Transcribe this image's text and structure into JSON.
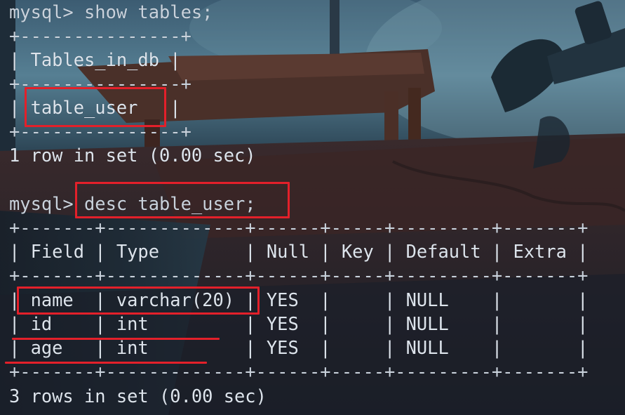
{
  "terminal": {
    "lines": {
      "cmd1": "mysql> show tables;",
      "border1": "+---------------+",
      "header1": "| Tables_in_db |",
      "border1b": "+---------------+",
      "row1": "| table_user   |",
      "border1c": "+---------------+",
      "result1": "1 row in set (0.00 sec)",
      "cmd2": "mysql> desc table_user;",
      "border2": "+-------+-------------+------+-----+---------+-------+",
      "header2": "| Field | Type        | Null | Key | Default | Extra |",
      "border2b": "+-------+-------------+------+-----+---------+-------+",
      "row_name": "| name  | varchar(20) | YES  |     | NULL    |       |",
      "row_id": "| id    | int         | YES  |     | NULL    |       |",
      "row_age": "| age   | int         | YES  |     | NULL    |       |",
      "border2c": "+-------+-------------+------+-----+---------+-------+",
      "result2": "3 rows in set (0.00 sec)"
    }
  },
  "colors": {
    "annotation": "#e3202a",
    "text": "#dde4ec"
  }
}
